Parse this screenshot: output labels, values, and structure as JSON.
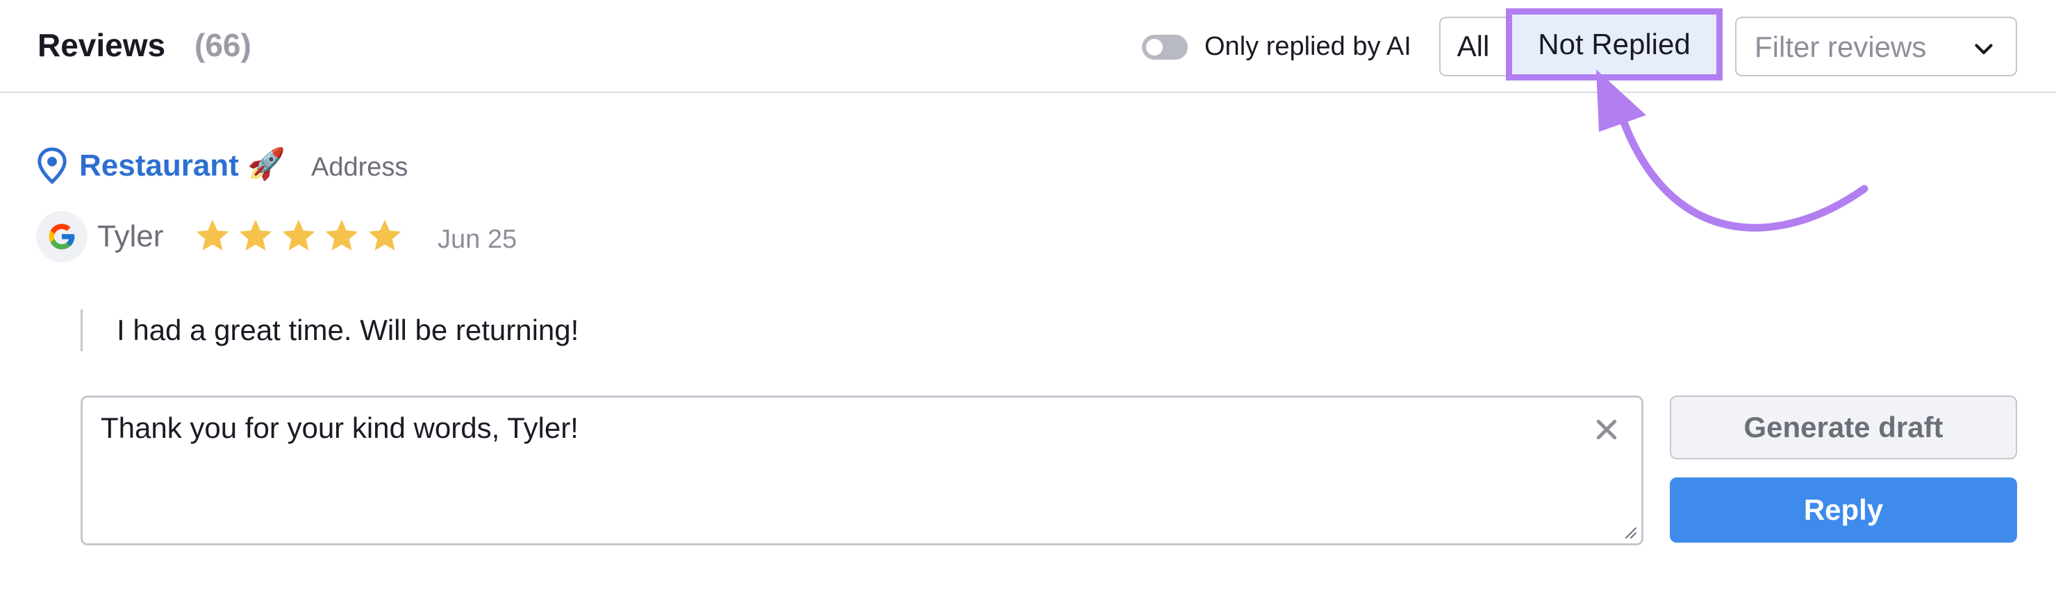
{
  "header": {
    "title": "Reviews",
    "count": "(66)",
    "ai_toggle": {
      "label": "Only replied by AI",
      "on": false
    },
    "segments": {
      "all": "All",
      "not_replied": "Not Replied",
      "selected": "not_replied"
    },
    "filter": {
      "placeholder": "Filter reviews",
      "icon": "chevron-down-icon"
    }
  },
  "location": {
    "icon": "map-pin-icon",
    "name": "Restaurant",
    "emoji": "🚀",
    "address": "Address"
  },
  "review": {
    "source_icon": "google-icon",
    "reviewer": "Tyler",
    "rating": 5,
    "max_rating": 5,
    "date": "Jun 25",
    "text": "I had a great time. Will be returning!"
  },
  "reply": {
    "value": "Thank you for your kind words, Tyler!",
    "generate_label": "Generate draft",
    "reply_label": "Reply"
  },
  "colors": {
    "accent": "#3f8bec",
    "link": "#2d6fd1",
    "highlight": "#b27ff0",
    "star": "#f5c24b"
  }
}
